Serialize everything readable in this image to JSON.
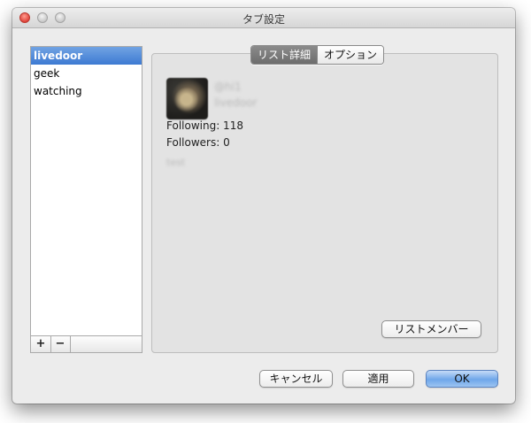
{
  "window": {
    "title": "タブ設定"
  },
  "sidebar": {
    "items": [
      {
        "label": "livedoor",
        "selected": true
      },
      {
        "label": "geek",
        "selected": false
      },
      {
        "label": "watching",
        "selected": false
      }
    ],
    "add_label": "+",
    "remove_label": "−"
  },
  "tabs": [
    {
      "label": "リスト詳細",
      "active": true
    },
    {
      "label": "オプション",
      "active": false
    }
  ],
  "detail": {
    "handle": "@hi1",
    "list_name": "livedoor",
    "following": "Following: 118",
    "followers": "Followers: 0",
    "mode": "test"
  },
  "buttons": {
    "list_members": "リストメンバー",
    "cancel": "キャンセル",
    "apply": "適用",
    "ok": "OK"
  },
  "colors": {
    "selection": "#3d7ad2",
    "default_button": "#6fa7ea"
  }
}
